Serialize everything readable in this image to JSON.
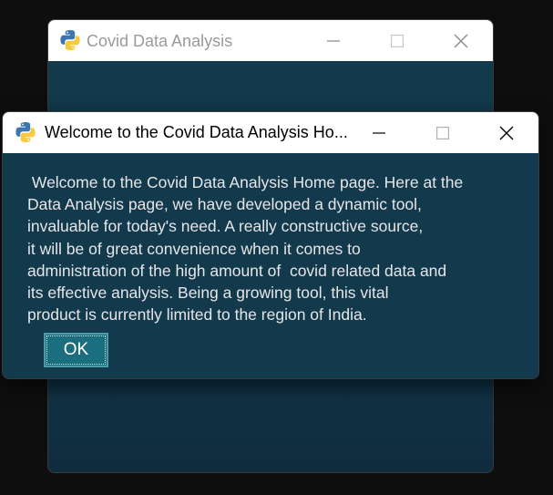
{
  "back_window": {
    "title": "Covid Data Analysis",
    "icon": "python-logo-icon"
  },
  "dialog": {
    "title": "Welcome to the Covid Data Analysis Ho...",
    "icon": "python-logo-icon",
    "message": " Welcome to the Covid Data Analysis Home page. Here at the\nData Analysis page, we have developed a dynamic tool,\ninvaluable for today's need. A really constructive source,\nit will be of great convenience when it comes to\nadministration of the high amount of  covid related data and\nits effective analysis. Being a growing tool, this vital\nproduct is currently limited to the region of India.",
    "ok_label": "OK"
  },
  "colors": {
    "window_bg": "#13394d",
    "titlebar_bg": "#ffffff",
    "button_bg": "#1a6e7d",
    "desktop_bg": "#0e0e0e"
  }
}
